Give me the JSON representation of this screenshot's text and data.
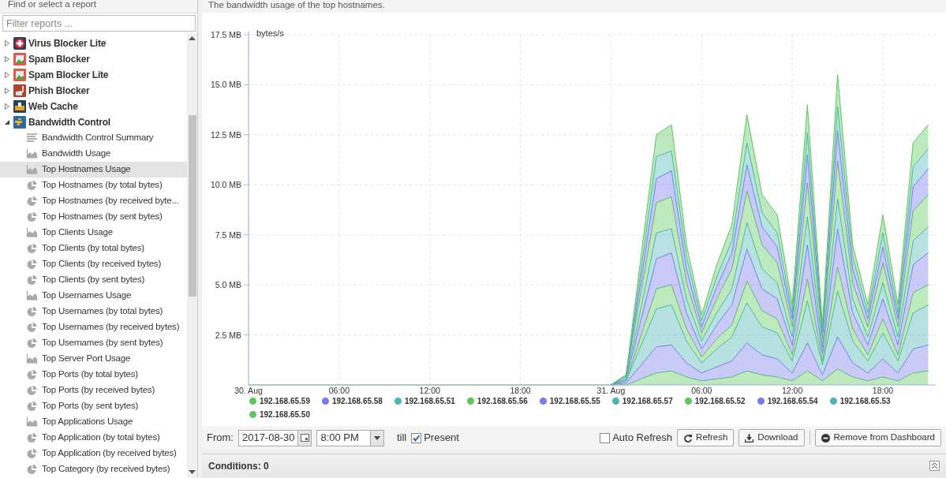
{
  "sidebar": {
    "title": "Find or select a report",
    "filter": {
      "placeholder": "Filter reports ..."
    },
    "tree": [
      {
        "label": "Virus Blocker Lite",
        "expanded": false
      },
      {
        "label": "Spam Blocker",
        "expanded": false
      },
      {
        "label": "Spam Blocker Lite",
        "expanded": false
      },
      {
        "label": "Phish Blocker",
        "expanded": false
      },
      {
        "label": "Web Cache",
        "expanded": false
      },
      {
        "label": "Bandwidth Control",
        "expanded": true,
        "children": [
          {
            "label": "Bandwidth Control Summary",
            "kind": "text",
            "selected": false
          },
          {
            "label": "Bandwidth Usage",
            "kind": "area",
            "selected": false
          },
          {
            "label": "Top Hostnames Usage",
            "kind": "area",
            "selected": true
          },
          {
            "label": "Top Hostnames (by total bytes)",
            "kind": "pie",
            "selected": false
          },
          {
            "label": "Top Hostnames (by received byte...",
            "kind": "pie",
            "selected": false
          },
          {
            "label": "Top Hostnames (by sent bytes)",
            "kind": "pie",
            "selected": false
          },
          {
            "label": "Top Clients Usage",
            "kind": "area",
            "selected": false
          },
          {
            "label": "Top Clients (by total bytes)",
            "kind": "pie",
            "selected": false
          },
          {
            "label": "Top Clients (by received bytes)",
            "kind": "pie",
            "selected": false
          },
          {
            "label": "Top Clients (by sent bytes)",
            "kind": "pie",
            "selected": false
          },
          {
            "label": "Top Usernames Usage",
            "kind": "area",
            "selected": false
          },
          {
            "label": "Top Usernames (by total bytes)",
            "kind": "pie",
            "selected": false
          },
          {
            "label": "Top Usernames (by received bytes)",
            "kind": "pie",
            "selected": false
          },
          {
            "label": "Top Usernames (by sent bytes)",
            "kind": "pie",
            "selected": false
          },
          {
            "label": "Top Server Port Usage",
            "kind": "area",
            "selected": false
          },
          {
            "label": "Top Ports (by total bytes)",
            "kind": "pie",
            "selected": false
          },
          {
            "label": "Top Ports (by received bytes)",
            "kind": "pie",
            "selected": false
          },
          {
            "label": "Top Ports (by sent bytes)",
            "kind": "pie",
            "selected": false
          },
          {
            "label": "Top Applications Usage",
            "kind": "area",
            "selected": false
          },
          {
            "label": "Top Application (by total bytes)",
            "kind": "pie",
            "selected": false
          },
          {
            "label": "Top Application (by received bytes)",
            "kind": "pie",
            "selected": false
          },
          {
            "label": "Top Category (by received bytes)",
            "kind": "pie",
            "selected": false
          }
        ]
      }
    ]
  },
  "report": {
    "description": "The bandwidth usage of the top hostnames.",
    "chart_data": {
      "type": "area",
      "stacked": true,
      "ylabel": "bytes/s",
      "grid": true,
      "x": [
        "2017-08-30T00:00",
        "2017-08-30T06:00",
        "2017-08-30T12:00",
        "2017-08-30T18:00",
        "2017-08-30T23:00",
        "2017-08-31T00:00",
        "2017-08-31T01:00",
        "2017-08-31T02:00",
        "2017-08-31T03:00",
        "2017-08-31T04:00",
        "2017-08-31T05:00",
        "2017-08-31T06:00",
        "2017-08-31T07:00",
        "2017-08-31T08:00",
        "2017-08-31T09:00",
        "2017-08-31T10:00",
        "2017-08-31T11:00",
        "2017-08-31T12:00",
        "2017-08-31T13:00",
        "2017-08-31T14:00",
        "2017-08-31T15:00",
        "2017-08-31T16:00",
        "2017-08-31T17:00",
        "2017-08-31T18:00",
        "2017-08-31T19:00",
        "2017-08-31T20:00",
        "2017-08-31T21:00"
      ],
      "xlim": [
        "2017-08-30T00:00",
        "2017-08-31T21:30"
      ],
      "ylim": [
        0,
        17.5
      ],
      "xticks": [
        {
          "value": "2017-08-30T00:00",
          "label": "30. Aug"
        },
        {
          "value": "2017-08-30T06:00",
          "label": "06:00"
        },
        {
          "value": "2017-08-30T12:00",
          "label": "12:00"
        },
        {
          "value": "2017-08-30T18:00",
          "label": "18:00"
        },
        {
          "value": "2017-08-31T00:00",
          "label": "31. Aug"
        },
        {
          "value": "2017-08-31T06:00",
          "label": "06:00"
        },
        {
          "value": "2017-08-31T12:00",
          "label": "12:00"
        },
        {
          "value": "2017-08-31T18:00",
          "label": "18:00"
        }
      ],
      "yticks": [
        {
          "value": 2.5,
          "label": "2.5 MB"
        },
        {
          "value": 5,
          "label": "5.0 MB"
        },
        {
          "value": 7.5,
          "label": "7.5 MB"
        },
        {
          "value": 10,
          "label": "10.0 MB"
        },
        {
          "value": 12.5,
          "label": "12.5 MB"
        },
        {
          "value": 15,
          "label": "15.0 MB"
        },
        {
          "value": 17.5,
          "label": "17.5 MB"
        }
      ],
      "series": [
        {
          "name": "192.168.65.59",
          "color": "#5bc75b",
          "values": [
            0,
            0,
            0,
            0,
            0,
            0,
            0,
            0.3,
            0.6,
            0.7,
            0.4,
            0.2,
            0.3,
            0.4,
            0.7,
            0.5,
            0.4,
            0.2,
            0.7,
            0.2,
            0.8,
            0.4,
            0.2,
            0.4,
            0.2,
            0.6,
            0.7
          ]
        },
        {
          "name": "192.168.65.58",
          "color": "#7a7af0",
          "values": [
            null,
            null,
            null,
            null,
            null,
            0,
            0.1,
            0.7,
            1.3,
            1.3,
            0.7,
            0.4,
            0.6,
            0.8,
            1.4,
            1,
            0.9,
            0.4,
            1.4,
            0.3,
            1.6,
            0.7,
            0.4,
            0.9,
            0.4,
            1.2,
            1.3
          ]
        },
        {
          "name": "192.168.65.51",
          "color": "#4cb5b5",
          "values": [
            null,
            null,
            null,
            null,
            null,
            0,
            0.1,
            1,
            1.9,
            2,
            1.1,
            0.5,
            0.9,
            1.2,
            2,
            1.4,
            1.3,
            0.6,
            2.1,
            0.5,
            2.3,
            1.1,
            0.6,
            1.3,
            0.6,
            1.8,
            2
          ]
        },
        {
          "name": "192.168.65.56",
          "color": "#5ac85a",
          "values": [
            null,
            null,
            null,
            null,
            null,
            0,
            0,
            0.5,
            1,
            1,
            0.6,
            0.3,
            0.5,
            0.6,
            1.1,
            0.8,
            0.7,
            0.3,
            1.1,
            0.2,
            1.2,
            0.6,
            0.3,
            0.7,
            0.3,
            1,
            1
          ]
        },
        {
          "name": "192.168.65.55",
          "color": "#7b7bef",
          "values": [
            null,
            null,
            null,
            null,
            null,
            0,
            0.1,
            0.8,
            1.5,
            1.6,
            0.8,
            0.4,
            0.7,
            1,
            1.6,
            1.1,
            1,
            0.5,
            1.7,
            0.4,
            1.9,
            0.8,
            0.5,
            1,
            0.5,
            1.4,
            1.6
          ]
        },
        {
          "name": "192.168.65.57",
          "color": "#4db4b4",
          "values": [
            null,
            null,
            null,
            null,
            null,
            0,
            0.1,
            0.6,
            1.3,
            1.2,
            0.7,
            0.4,
            0.6,
            0.8,
            1.3,
            1,
            0.8,
            0.4,
            1.4,
            0.3,
            1.5,
            0.7,
            0.4,
            0.8,
            0.4,
            1.2,
            1.3
          ]
        },
        {
          "name": "192.168.65.52",
          "color": "#5cc65c",
          "values": [
            null,
            null,
            null,
            null,
            null,
            0,
            0.1,
            0.8,
            1.5,
            1.6,
            0.8,
            0.4,
            0.7,
            1,
            1.6,
            1.2,
            1,
            0.5,
            1.7,
            0.4,
            1.9,
            0.8,
            0.5,
            1,
            0.5,
            1.5,
            1.6
          ]
        },
        {
          "name": "192.168.65.54",
          "color": "#7979f1",
          "values": [
            null,
            null,
            null,
            null,
            null,
            0,
            0,
            0.6,
            1.2,
            1.3,
            0.7,
            0.3,
            0.6,
            0.8,
            1.3,
            0.9,
            0.8,
            0.4,
            1.4,
            0.3,
            1.5,
            0.7,
            0.4,
            0.8,
            0.4,
            1.2,
            1.3
          ]
        },
        {
          "name": "192.168.65.53",
          "color": "#4bb6b6",
          "values": [
            null,
            null,
            null,
            null,
            null,
            0,
            0,
            0.5,
            1.1,
            1,
            0.6,
            0.3,
            0.5,
            0.6,
            1.1,
            0.7,
            0.7,
            0.3,
            1.1,
            0.2,
            1.2,
            0.6,
            0.3,
            0.7,
            0.3,
            1,
            1
          ]
        },
        {
          "name": "192.168.65.50",
          "color": "#5dc55d",
          "values": [
            null,
            null,
            null,
            null,
            null,
            0,
            0,
            0.7,
            1.1,
            1.3,
            0.6,
            0.3,
            0.6,
            0.8,
            1.4,
            0.9,
            0.9,
            0.4,
            1.4,
            0.2,
            1.6,
            0.6,
            0.4,
            0.9,
            0.4,
            1.2,
            1.2
          ]
        }
      ]
    }
  },
  "toolbar": {
    "from_label": "From:",
    "date": "2017-08-30",
    "time": "8:00 PM",
    "till_label": "till",
    "present": {
      "label": "Present",
      "checked": true
    },
    "auto_refresh": {
      "label": "Auto Refresh",
      "checked": false
    },
    "buttons": [
      {
        "label": "Refresh",
        "kind": "refresh"
      },
      {
        "label": "Download",
        "kind": "download"
      },
      {
        "label": "Remove from Dashboard",
        "kind": "remove"
      }
    ]
  },
  "conditions": {
    "title": "Conditions: 0"
  }
}
